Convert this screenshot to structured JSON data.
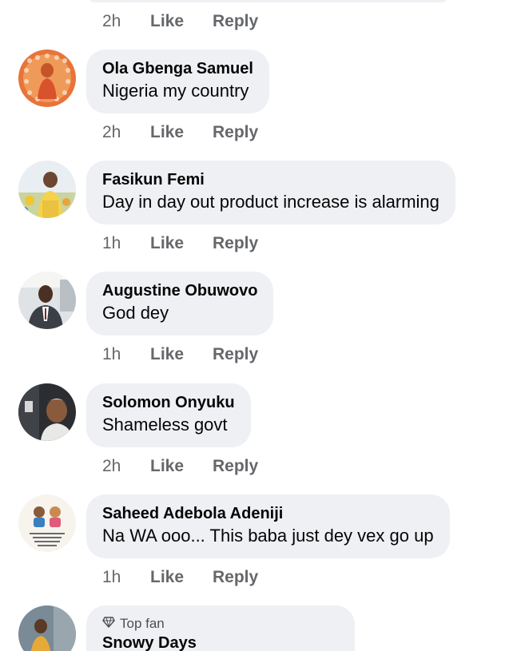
{
  "first_actions": {
    "time": "2h",
    "like": "Like",
    "reply": "Reply"
  },
  "comments": [
    {
      "name": "Ola Gbenga Samuel",
      "text": "Nigeria my country",
      "time": "2h",
      "like": "Like",
      "reply": "Reply",
      "avatar_icon": "orange-figure-avatar"
    },
    {
      "name": "Fasikun Femi",
      "text": "Day in day out product increase is alarming",
      "time": "1h",
      "like": "Like",
      "reply": "Reply",
      "avatar_icon": "outdoor-person-avatar"
    },
    {
      "name": "Augustine Obuwovo",
      "text": "God dey",
      "time": "1h",
      "like": "Like",
      "reply": "Reply",
      "avatar_icon": "man-in-suit-avatar"
    },
    {
      "name": "Solomon Onyuku",
      "text": "Shameless govt",
      "time": "2h",
      "like": "Like",
      "reply": "Reply",
      "avatar_icon": "man-portrait-avatar"
    },
    {
      "name": "Saheed Adebola Adeniji",
      "text": "Na WA ooo... This baba just dey vex go up",
      "time": "1h",
      "like": "Like",
      "reply": "Reply",
      "avatar_icon": "cartoon-quote-avatar"
    }
  ],
  "last_comment": {
    "badge": "Top fan",
    "badge_icon": "diamond-icon",
    "name": "Snowy Days",
    "avatar_icon": "person-avatar"
  },
  "colors": {
    "bubble": "#eef0f3",
    "meta": "#65676b",
    "text": "#050505"
  }
}
